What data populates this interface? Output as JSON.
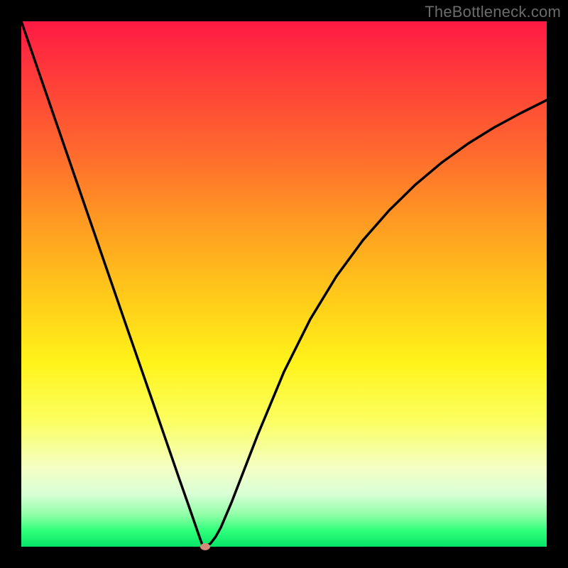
{
  "watermark": "TheBottleneck.com",
  "chart_data": {
    "type": "line",
    "title": "",
    "xlabel": "",
    "ylabel": "",
    "xlim": [
      0,
      100
    ],
    "ylim": [
      0,
      100
    ],
    "grid": false,
    "series": [
      {
        "name": "curve",
        "x": [
          0,
          5,
          10,
          15,
          20,
          25,
          28,
          30,
          32,
          33,
          34,
          34.5,
          35,
          36,
          37,
          38,
          40,
          45,
          50,
          55,
          60,
          65,
          70,
          75,
          80,
          85,
          90,
          95,
          100
        ],
        "y": [
          100,
          85.5,
          71,
          56.5,
          42,
          27.6,
          18.9,
          13.1,
          7.4,
          4.5,
          1.6,
          0.2,
          0,
          0.6,
          1.9,
          3.7,
          8.4,
          21.3,
          33.3,
          43.3,
          51.5,
          58.3,
          64,
          68.9,
          73.1,
          76.7,
          79.8,
          82.5,
          85
        ]
      }
    ],
    "marker": {
      "x": 35,
      "y": 0
    },
    "background": {
      "type": "vertical-gradient",
      "stops": [
        {
          "pos": 0,
          "color": "#ff1a44"
        },
        {
          "pos": 25,
          "color": "#ff6a2e"
        },
        {
          "pos": 52,
          "color": "#ffc91a"
        },
        {
          "pos": 65,
          "color": "#fff31a"
        },
        {
          "pos": 85,
          "color": "#f4ffc4"
        },
        {
          "pos": 100,
          "color": "#06e667"
        }
      ]
    }
  }
}
